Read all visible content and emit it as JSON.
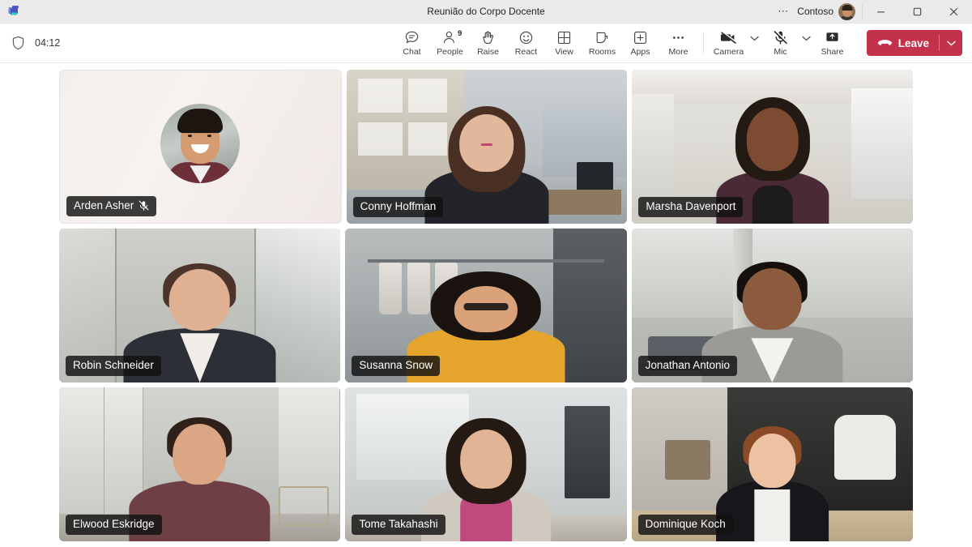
{
  "window": {
    "app_icon": "teams-logo-icon",
    "title": "Reunião do Corpo Docente",
    "overflow_icon": "ellipsis-icon",
    "org_name": "Contoso",
    "avatar": "user-avatar",
    "minimize_icon": "minimize-icon",
    "maximize_icon": "maximize-icon",
    "close_icon": "close-icon"
  },
  "commandbar": {
    "shield_icon": "shield-icon",
    "timer": "04:12",
    "buttons": [
      {
        "icon": "chat-icon",
        "label": "Chat"
      },
      {
        "icon": "people-icon",
        "label": "People",
        "badge": "9"
      },
      {
        "icon": "raise-hand-icon",
        "label": "Raise"
      },
      {
        "icon": "react-smiley-icon",
        "label": "React"
      },
      {
        "icon": "view-grid-icon",
        "label": "View"
      },
      {
        "icon": "rooms-icon",
        "label": "Rooms"
      },
      {
        "icon": "apps-plus-icon",
        "label": "Apps"
      },
      {
        "icon": "more-ellipsis-icon",
        "label": "More"
      }
    ],
    "camera": {
      "icon": "camera-off-icon",
      "label": "Camera",
      "caret": "chevron-down-icon",
      "muted": true
    },
    "mic": {
      "icon": "mic-off-icon",
      "label": "Mic",
      "caret": "chevron-down-icon",
      "muted": true
    },
    "share": {
      "icon": "share-screen-icon",
      "label": "Share"
    },
    "leave": {
      "icon": "hangup-icon",
      "label": "Leave",
      "caret": "chevron-down-icon",
      "color": "#c4314b"
    }
  },
  "stage": {
    "rows": [
      [
        {
          "name": "Arden Asher",
          "video": false,
          "muted": true
        },
        {
          "name": "Conny Hoffman",
          "video": true,
          "muted": false
        },
        {
          "name": "Marsha Davenport",
          "video": true,
          "muted": false
        }
      ],
      [
        {
          "name": "Robin Schneider",
          "video": true,
          "muted": false
        },
        {
          "name": "Susanna Snow",
          "video": true,
          "muted": false
        },
        {
          "name": "Jonathan Antonio",
          "video": true,
          "muted": false
        }
      ],
      [
        {
          "name": "Elwood Eskridge",
          "video": true,
          "muted": false
        },
        {
          "name": "Tome Takahashi",
          "video": true,
          "muted": false
        },
        {
          "name": "Dominique Koch",
          "video": true,
          "muted": false
        }
      ]
    ]
  }
}
